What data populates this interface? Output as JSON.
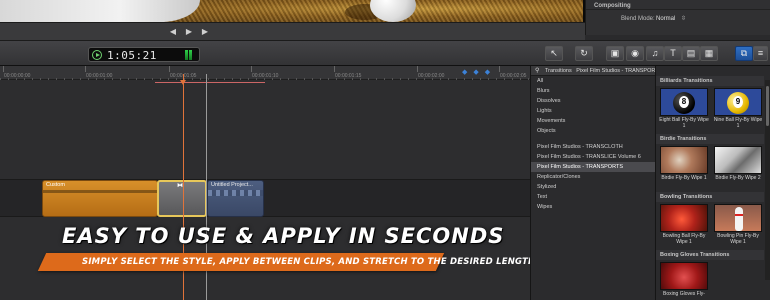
{
  "inspector": {
    "title": "Compositing",
    "blend_label": "Blend Mode:",
    "blend_value": "Normal"
  },
  "transport": {
    "prev_icon": "skip-back-icon",
    "play_icon": "play-icon",
    "next_icon": "skip-forward-icon"
  },
  "toolbar": {
    "timecode": "00:00:01:05:21",
    "timecode_display": "1:05:21",
    "tools": [
      "select-tool-icon",
      "retime-icon",
      "clip-appearance-icon",
      "camera-icon",
      "music-icon",
      "title-icon",
      "generator-icon",
      "theme-icon",
      "transition-browser-icon"
    ]
  },
  "timeline": {
    "ruler": [
      "00:00:00:00",
      "00:00:01:00",
      "00:00:01:05",
      "00:00:01:10",
      "00:00:01:15",
      "00:00:02:00",
      "00:00:02:05"
    ],
    "clip1_label": "Custom",
    "clip2_label": "Untitled Project..."
  },
  "banner": {
    "headline": "EASY TO USE & APPLY IN SECONDS",
    "subline": "SIMPLY SELECT THE STYLE, APPLY BETWEEN CLIPS, AND STRETCH TO THE DESIRED LENGTH"
  },
  "browser": {
    "header": "Transitions",
    "crumb": "Pixel Film Studios - TRANSPORTS",
    "categories": [
      "All",
      "Blurs",
      "Dissolves",
      "Lights",
      "Movements",
      "Objects",
      "Pixel Film Studios - TRANSCLOTH",
      "Pixel Film Studios - TRANSLICE Volume 6",
      "Pixel Film Studios - TRANSPORTS",
      "Replicator/Clones",
      "Stylized",
      "Text",
      "Wipes"
    ],
    "selected_index": 8
  },
  "gallery": {
    "groups": [
      {
        "title": "Billiards Transitions",
        "items": [
          "Eight Ball Fly-By Wipe 1",
          "Nine Ball Fly-By Wipe 1"
        ]
      },
      {
        "title": "Birdie Transitions",
        "items": [
          "Birdie Fly-By Wipe 1",
          "Birdie Fly-By Wipe 2"
        ]
      },
      {
        "title": "Bowling Transitions",
        "items": [
          "Bowling Ball Fly-By Wipe 1",
          "Bowling Pin Fly-By Wipe 1"
        ]
      },
      {
        "title": "Boxing Gloves Transitions",
        "items": [
          "Boxing Gloves Fly-"
        ]
      }
    ]
  },
  "colors": {
    "accent": "#dd6a1b",
    "playhead": "#e0733a",
    "selection": "#e7c75a",
    "tool_active": "#2f6fc4"
  }
}
